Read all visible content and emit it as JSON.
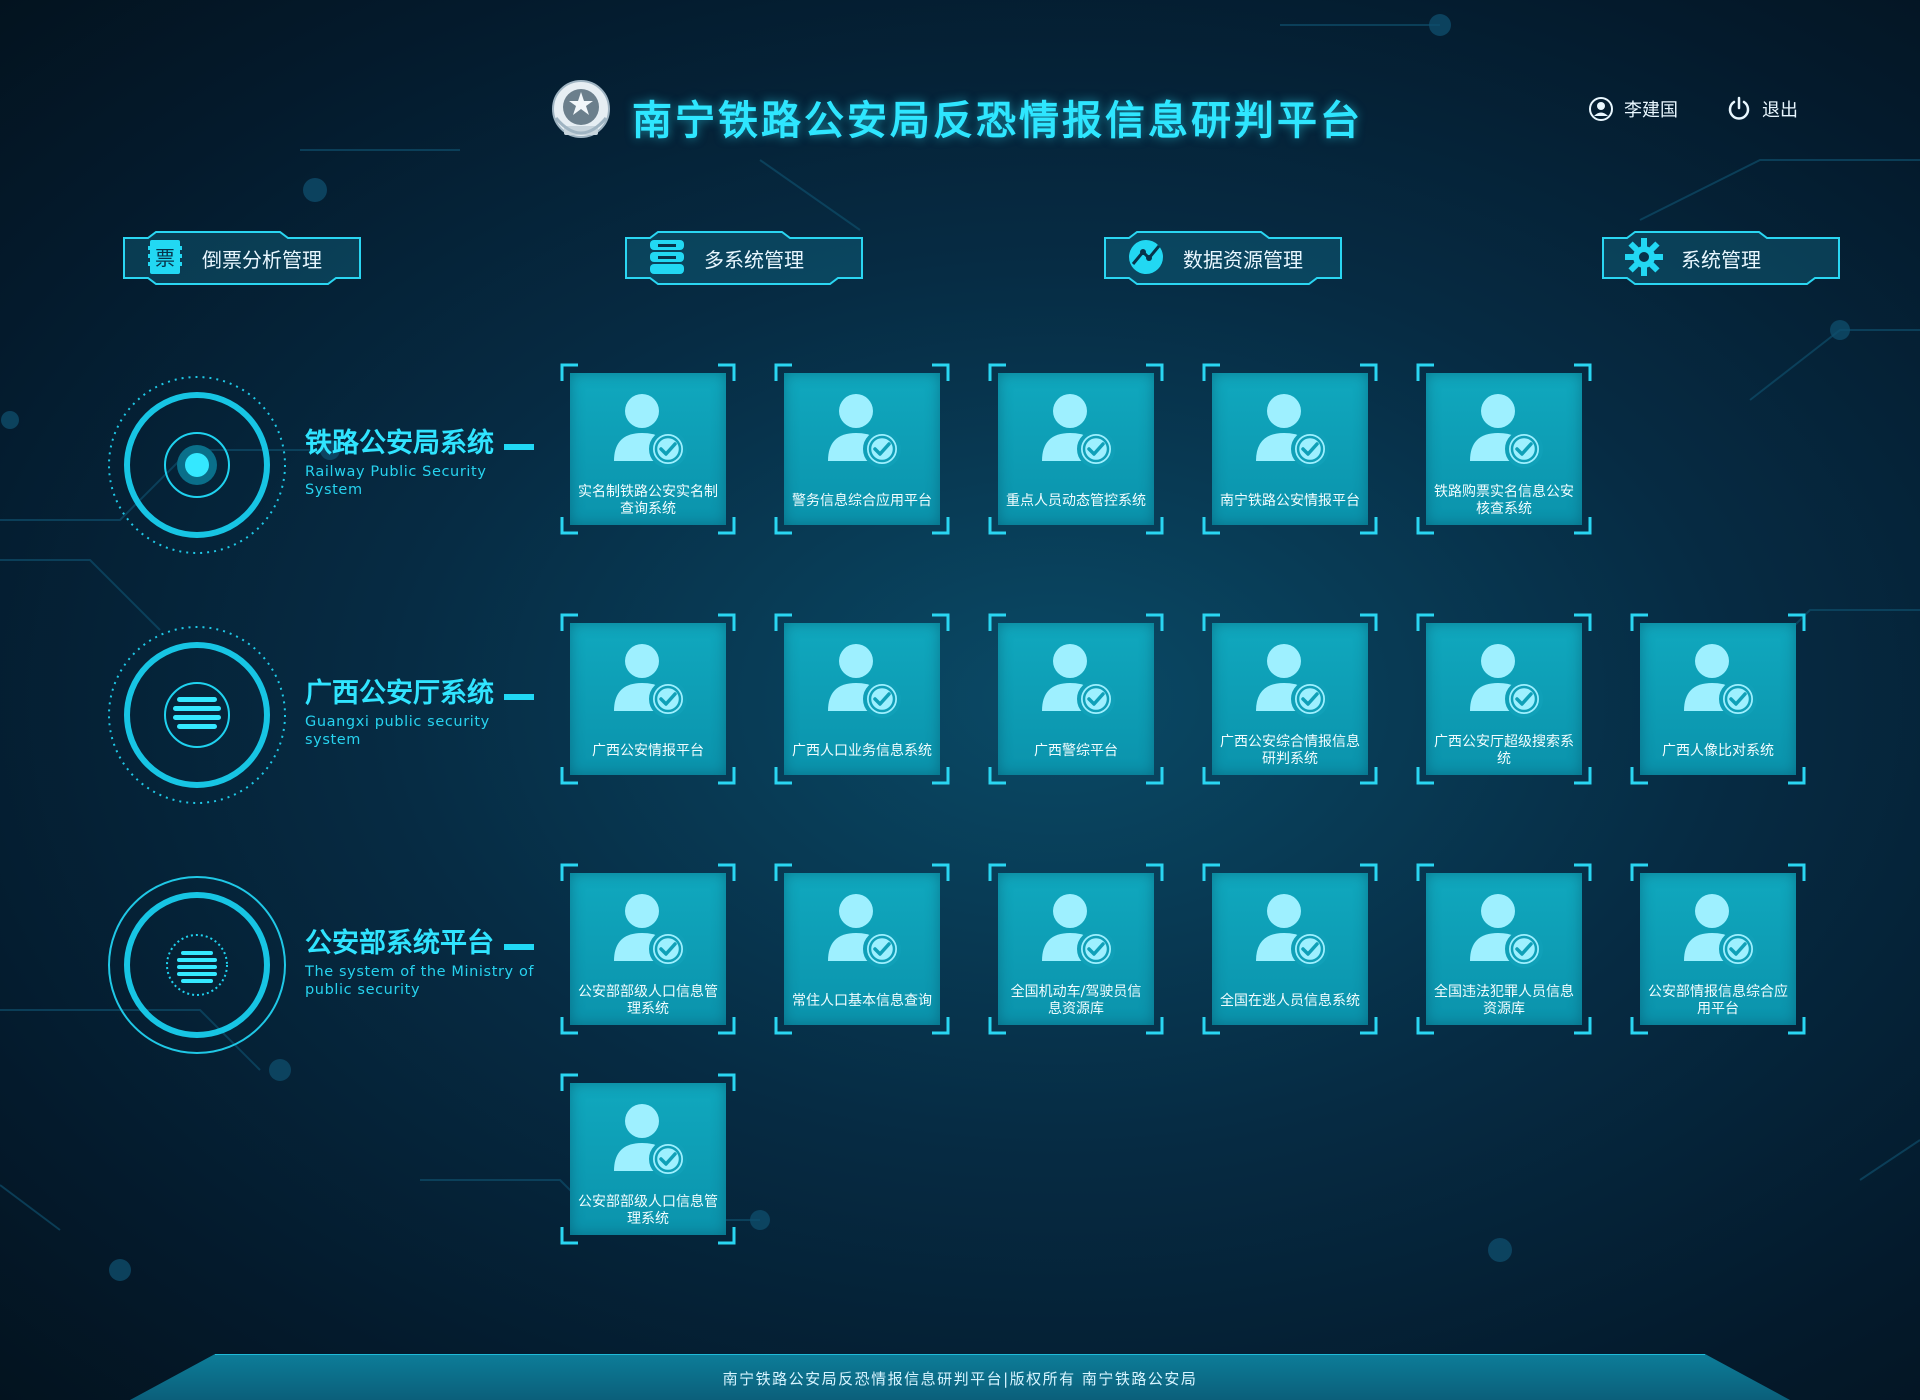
{
  "header": {
    "title": "南宁铁路公安局反恐情报信息研判平台",
    "user_name": "李建国",
    "logout_label": "退出"
  },
  "nav": [
    {
      "label": "倒票分析管理",
      "icon": "ticket-icon"
    },
    {
      "label": "多系统管理",
      "icon": "multi-system-icon"
    },
    {
      "label": "数据资源管理",
      "icon": "data-resource-icon"
    },
    {
      "label": "系统管理",
      "icon": "gear-icon"
    }
  ],
  "groups": [
    {
      "title": "铁路公安局系统",
      "subtitle": "Railway Public Security System",
      "icon": "target-ring-icon",
      "tiles": [
        "实名制铁路公安实名制查询系统",
        "警务信息综合应用平台",
        "重点人员动态管控系统",
        "南宁铁路公安情报平台",
        "铁路购票实名信息公安核查系统"
      ]
    },
    {
      "title": "广西公安厅系统",
      "subtitle": "Guangxi public security system",
      "icon": "striped-globe-icon",
      "tiles": [
        "广西公安情报平台",
        "广西人口业务信息系统",
        "广西警综平台",
        "广西公安综合情报信息研判系统",
        "广西公安厅超级搜索系统",
        "广西人像比对系统"
      ]
    },
    {
      "title": "公安部系统平台",
      "subtitle": "The system  of the Ministry of public security",
      "icon": "striped-globe-icon",
      "tiles": [
        "公安部部级人口信息管理系统",
        "常住人口基本信息查询",
        "全国机动车/驾驶员信息资源库",
        "全国在逃人员信息系统",
        "全国违法犯罪人员信息资源库",
        "公安部情报信息综合应用平台",
        "公安部部级人口信息管理系统"
      ]
    }
  ],
  "footer": {
    "text": "南宁铁路公安局反恐情报信息研判平台|版权所有   南宁铁路公安局"
  },
  "colors": {
    "accent": "#2ee6ff",
    "tile": "#10a8be",
    "background": "#062b43"
  }
}
